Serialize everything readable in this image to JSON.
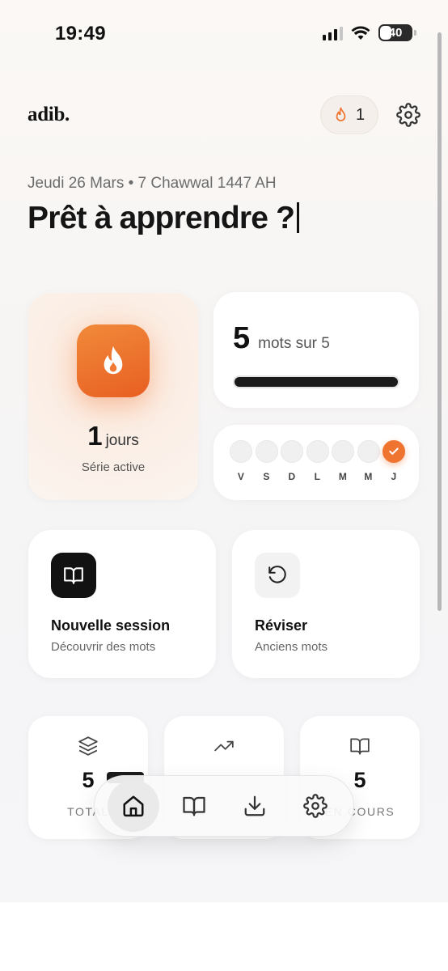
{
  "status_bar": {
    "time": "19:49",
    "battery": "40"
  },
  "header": {
    "logo": "adib.",
    "streak_count": "1"
  },
  "greeting": {
    "date": "Jeudi 26 Mars • 7 Chawwal 1447 AH",
    "headline": "Prêt à apprendre ?"
  },
  "streak_card": {
    "count": "1",
    "unit": "jours",
    "label": "Série active"
  },
  "goal_card": {
    "done": "5",
    "text": "mots sur 5",
    "progress": 1.0
  },
  "week": [
    {
      "letter": "V",
      "done": false
    },
    {
      "letter": "S",
      "done": false
    },
    {
      "letter": "D",
      "done": false
    },
    {
      "letter": "L",
      "done": false
    },
    {
      "letter": "M",
      "done": false
    },
    {
      "letter": "M",
      "done": false
    },
    {
      "letter": "J",
      "done": true
    }
  ],
  "actions": {
    "session": {
      "title": "Nouvelle session",
      "subtitle": "Découvrir des mots",
      "icon": "book-open-icon"
    },
    "review": {
      "title": "Réviser",
      "subtitle": "Anciens mots",
      "icon": "rotate-ccw-icon"
    }
  },
  "stats": {
    "total": {
      "value": "5",
      "label": "TOTAL",
      "icon": "layers-icon"
    },
    "trend": {
      "value": "",
      "label": "",
      "icon": "trending-up-icon"
    },
    "course": {
      "value": "5",
      "label": "EN COURS",
      "icon": "book-open-icon"
    }
  },
  "tabbar": [
    "home-icon",
    "book-open-icon",
    "download-icon",
    "gear-icon"
  ],
  "colors": {
    "accent": "#ef7430",
    "dark": "#121212"
  }
}
